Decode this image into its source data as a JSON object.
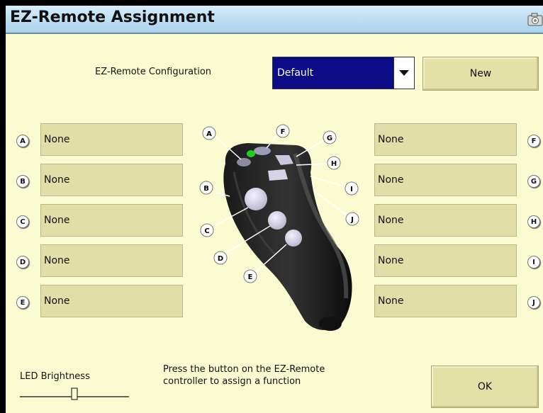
{
  "window": {
    "title": "EZ-Remote Assignment",
    "camera_icon": "camera-icon"
  },
  "config": {
    "label": "EZ-Remote Configuration",
    "selected": "Default",
    "new_label": "New"
  },
  "left_buttons": [
    {
      "letter": "A",
      "value": "None"
    },
    {
      "letter": "B",
      "value": "None"
    },
    {
      "letter": "C",
      "value": "None"
    },
    {
      "letter": "D",
      "value": "None"
    },
    {
      "letter": "E",
      "value": "None"
    }
  ],
  "right_buttons": [
    {
      "letter": "F",
      "value": "None"
    },
    {
      "letter": "G",
      "value": "None"
    },
    {
      "letter": "H",
      "value": "None"
    },
    {
      "letter": "I",
      "value": "None"
    },
    {
      "letter": "J",
      "value": "None"
    }
  ],
  "diagram_labels": [
    "A",
    "B",
    "C",
    "D",
    "E",
    "F",
    "G",
    "H",
    "I",
    "J"
  ],
  "brightness": {
    "label": "LED Brightness",
    "level": 0.5
  },
  "instruction": {
    "line1": "Press the button on the EZ-Remote",
    "line2": "controller to assign a function"
  },
  "ok_label": "OK",
  "colors": {
    "title_bar": "#a9d2ec",
    "background": "#fbfbd1",
    "field": "#e1dfa7",
    "dropdown": "#0c0c86",
    "led": "#22cc22"
  }
}
